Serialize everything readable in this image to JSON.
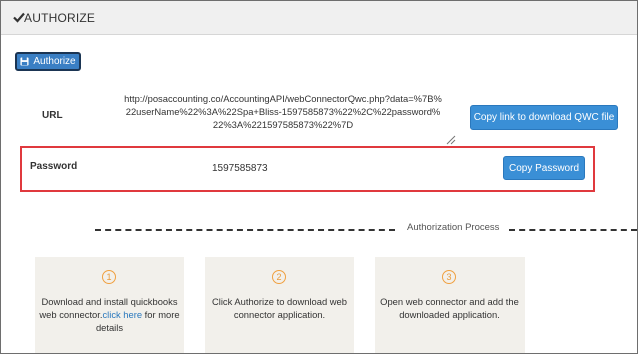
{
  "header": {
    "title": "AUTHORIZE",
    "icon": "check-icon"
  },
  "authorize_button": {
    "label": "Authorize",
    "icon": "floppy-disk-icon",
    "color": "#3a7fc4"
  },
  "url": {
    "label": "URL",
    "value": "http://posaccounting.co/AccountingAPI/webConnectorQwc.php?data=%7B%22userName%22%3A%22Spa+Bliss-1597585873%22%2C%22password%22%3A%221597585873%22%7D"
  },
  "copy_link_button": {
    "label": "Copy link to download QWC file"
  },
  "password": {
    "label": "Password",
    "value": "1597585873"
  },
  "copy_password_button": {
    "label": "Copy Password"
  },
  "highlight_color": "#e0393e",
  "process": {
    "label": "Authorization Process",
    "steps": [
      {
        "number": "1",
        "text_before": "Download and install quickbooks web connector.",
        "link": "click here",
        "text_after": " for more details"
      },
      {
        "number": "2",
        "text": "Click Authorize to download web connector application."
      },
      {
        "number": "3",
        "text": "Open web connector and add the downloaded application."
      }
    ]
  }
}
